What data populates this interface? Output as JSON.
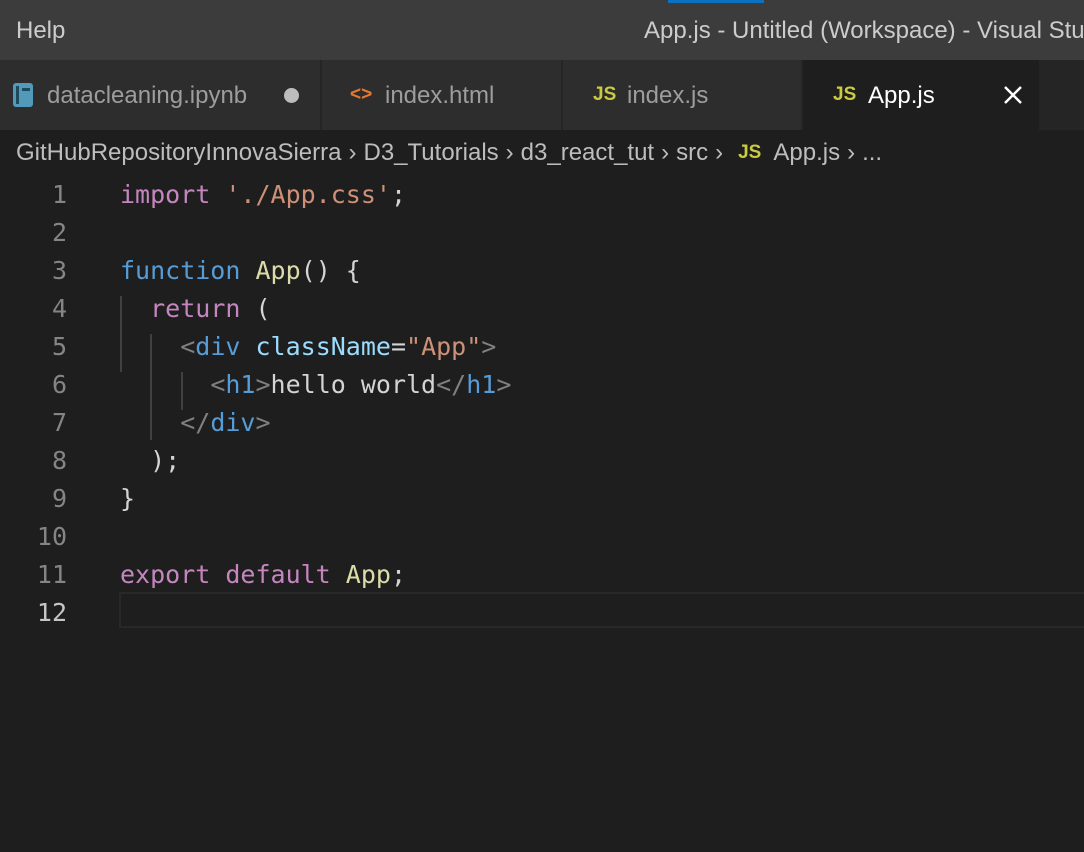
{
  "titlebar": {
    "menu_help": "Help",
    "window_title": "App.js - Untitled (Workspace) - Visual Studio Code"
  },
  "tabs": [
    {
      "label": "datacleaning.ipynb",
      "icon": "notebook-icon",
      "dirty": true,
      "active": false
    },
    {
      "label": "index.html",
      "icon": "html-icon",
      "icon_text": "<>",
      "active": false
    },
    {
      "label": "index.js",
      "icon": "js-icon",
      "icon_text": "JS",
      "active": false
    },
    {
      "label": "App.js",
      "icon": "js-icon",
      "icon_text": "JS",
      "active": true
    }
  ],
  "breadcrumb": {
    "items": [
      "GitHubRepositoryInnovaSierra",
      "D3_Tutorials",
      "d3_react_tut",
      "src"
    ],
    "file_icon_text": "JS",
    "file": "App.js",
    "more": "..."
  },
  "editor": {
    "current_line": 12,
    "lines": [
      {
        "n": "1",
        "tokens": [
          [
            "kw-ctrl",
            "import"
          ],
          [
            "txt",
            " "
          ],
          [
            "str",
            "'./App.css'"
          ],
          [
            "txt",
            ";"
          ]
        ]
      },
      {
        "n": "2",
        "tokens": []
      },
      {
        "n": "3",
        "tokens": [
          [
            "kw-decl",
            "function"
          ],
          [
            "txt",
            " "
          ],
          [
            "fn",
            "App"
          ],
          [
            "txt",
            "() {"
          ]
        ]
      },
      {
        "n": "4",
        "tokens": [
          [
            "txt",
            "  "
          ],
          [
            "kw-ctrl",
            "return"
          ],
          [
            "txt",
            " ("
          ]
        ]
      },
      {
        "n": "5",
        "tokens": [
          [
            "txt",
            "    "
          ],
          [
            "tag-punct",
            "<"
          ],
          [
            "tag",
            "div"
          ],
          [
            "txt",
            " "
          ],
          [
            "attr",
            "className"
          ],
          [
            "txt",
            "="
          ],
          [
            "str",
            "\"App\""
          ],
          [
            "tag-punct",
            ">"
          ]
        ]
      },
      {
        "n": "6",
        "tokens": [
          [
            "txt",
            "      "
          ],
          [
            "tag-punct",
            "<"
          ],
          [
            "tag",
            "h1"
          ],
          [
            "tag-punct",
            ">"
          ],
          [
            "txt",
            "hello world"
          ],
          [
            "tag-punct",
            "</"
          ],
          [
            "tag",
            "h1"
          ],
          [
            "tag-punct",
            ">"
          ]
        ]
      },
      {
        "n": "7",
        "tokens": [
          [
            "txt",
            "    "
          ],
          [
            "tag-punct",
            "</"
          ],
          [
            "tag",
            "div"
          ],
          [
            "tag-punct",
            ">"
          ]
        ]
      },
      {
        "n": "8",
        "tokens": [
          [
            "txt",
            "  );"
          ]
        ]
      },
      {
        "n": "9",
        "tokens": [
          [
            "txt",
            "}"
          ]
        ]
      },
      {
        "n": "10",
        "tokens": []
      },
      {
        "n": "11",
        "tokens": [
          [
            "kw-ctrl",
            "export"
          ],
          [
            "txt",
            " "
          ],
          [
            "kw-ctrl",
            "default"
          ],
          [
            "txt",
            " "
          ],
          [
            "fn",
            "App"
          ],
          [
            "txt",
            ";"
          ]
        ]
      },
      {
        "n": "12",
        "tokens": []
      }
    ]
  },
  "colors": {
    "accent_progress": "#0e70c0",
    "js_badge": "#cbcb41",
    "html_badge": "#e37933",
    "notebook_badge": "#519aba"
  }
}
